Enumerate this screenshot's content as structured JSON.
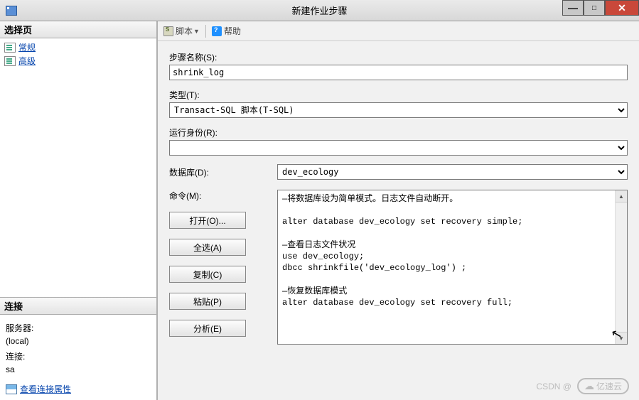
{
  "window": {
    "title": "新建作业步骤",
    "min": "—",
    "max": "□",
    "close": "✕"
  },
  "left": {
    "header": "选择页",
    "nav": [
      {
        "label": "常规"
      },
      {
        "label": "高级"
      }
    ],
    "conn_header": "连接",
    "server_label": "服务器:",
    "server_value": "(local)",
    "conn_label": "连接:",
    "conn_value": "sa",
    "view_props": "查看连接属性"
  },
  "toolbar": {
    "script": "脚本",
    "help": "帮助"
  },
  "form": {
    "step_name_label": "步骤名称(S):",
    "step_name_value": "shrink_log",
    "type_label": "类型(T):",
    "type_value": "Transact-SQL 脚本(T-SQL)",
    "runas_label": "运行身份(R):",
    "runas_value": "",
    "database_label": "数据库(D):",
    "database_value": "dev_ecology",
    "command_label": "命令(M):",
    "command_value": "—将数据库设为简单模式。日志文件自动断开。\n\nalter database dev_ecology set recovery simple;\n\n—查看日志文件状况\nuse dev_ecology;\ndbcc shrinkfile('dev_ecology_log') ;\n\n—恢复数据库模式\nalter database dev_ecology set recovery full;",
    "buttons": {
      "open": "打开(O)...",
      "select_all": "全选(A)",
      "copy": "复制(C)",
      "paste": "粘贴(P)",
      "parse": "分析(E)"
    }
  },
  "watermark": {
    "csdn": "CSDN @",
    "brand": "亿速云"
  }
}
